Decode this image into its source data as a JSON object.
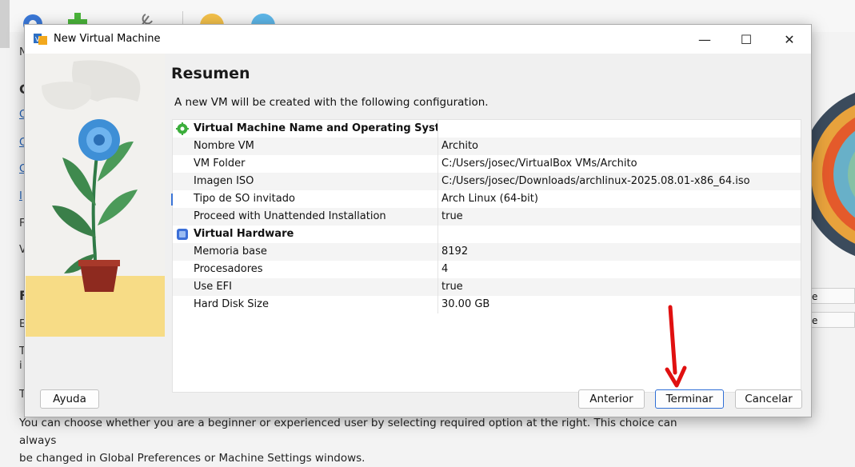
{
  "background_app": {
    "side_letters": [
      "N",
      "C",
      "C",
      "C",
      "C",
      "I",
      "F",
      "V",
      "F",
      "E",
      "T",
      "i",
      "T"
    ],
    "footer_text_line1": "You can choose whether you are a beginner or experienced user by selecting required option at the right. This choice can always",
    "footer_text_line2": "be changed in Global Preferences or Machine Settings windows.",
    "right_field_1": "e",
    "right_field_2": "e"
  },
  "dialog": {
    "title": "New Virtual Machine",
    "minimize": "—",
    "maximize": "☐",
    "close": "✕",
    "heading": "Resumen",
    "intro": "A new VM will be created with the following configuration.",
    "sections": [
      {
        "title": "Virtual Machine Name and Operating System",
        "icon": "gear-icon",
        "rows": [
          {
            "label": "Nombre VM",
            "value": "Archito"
          },
          {
            "label": "VM Folder",
            "value": "C:/Users/josec/VirtualBox VMs/Archito"
          },
          {
            "label": "Imagen ISO",
            "value": "C:/Users/josec/Downloads/archlinux-2025.08.01-x86_64.iso"
          },
          {
            "label": "Tipo de SO invitado",
            "value": "Arch Linux (64-bit)"
          },
          {
            "label": "Proceed with Unattended Installation",
            "value": "true"
          }
        ]
      },
      {
        "title": "Virtual Hardware",
        "icon": "chip-icon",
        "rows": [
          {
            "label": "Memoria base",
            "value": "8192"
          },
          {
            "label": "Procesadores",
            "value": "4"
          },
          {
            "label": "Use EFI",
            "value": "true"
          },
          {
            "label": "Hard Disk Size",
            "value": "30.00 GB"
          }
        ]
      }
    ],
    "buttons": {
      "help": "Ayuda",
      "back": "Anterior",
      "finish": "Terminar",
      "cancel": "Cancelar"
    }
  },
  "colors": {
    "accent": "#2f6fd6",
    "annotation_arrow": "#e01010"
  }
}
